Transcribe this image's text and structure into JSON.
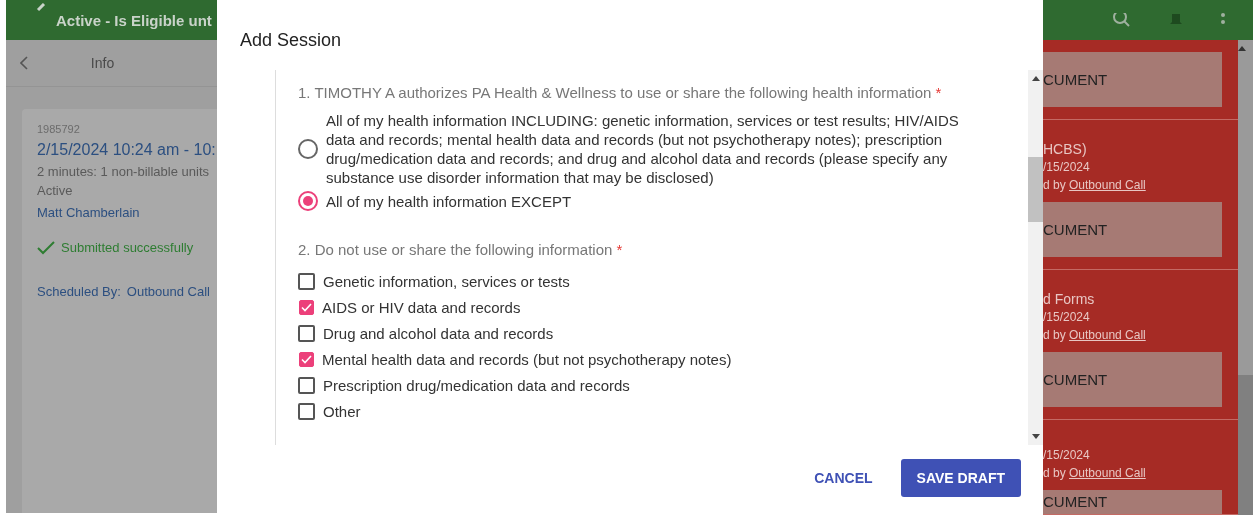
{
  "app_header": {
    "title": "Active - Is Eligible unt"
  },
  "info_bar": {
    "title": "Info"
  },
  "session_card": {
    "id": "1985792",
    "time": "2/15/2024 10:24 am - 10:",
    "duration": "2 minutes: 1 non-billable units",
    "status": "Active",
    "staff": "Matt Chamberlain",
    "result": "Submitted successfully",
    "scheduled_label": "Scheduled By:",
    "scheduled_by": "Outbound Call"
  },
  "dialog": {
    "title": "Add Session",
    "question_1": {
      "label": "1. TIMOTHY A authorizes PA Health & Wellness to use or share the following health information",
      "required": "*",
      "options": [
        {
          "label": "All of my health information INCLUDING: genetic information, services or test results; HIV/AIDS data and records; mental health data and records (but not psychotherapy notes); prescription drug/medication data and records; and drug and alcohol data and records (please specify any substance use disorder information that may be disclosed)",
          "selected": false
        },
        {
          "label": "All of my health information EXCEPT",
          "selected": true
        }
      ]
    },
    "question_2": {
      "label": "2. Do not use or share the following information",
      "required": "*",
      "options": [
        {
          "label": "Genetic information, services or tests",
          "checked": false
        },
        {
          "label": "AIDS or HIV data and records",
          "checked": true
        },
        {
          "label": "Drug and alcohol data and records",
          "checked": false
        },
        {
          "label": "Mental health data and records (but not psychotherapy notes)",
          "checked": true
        },
        {
          "label": "Prescription drug/medication data and records",
          "checked": false
        },
        {
          "label": "Other",
          "checked": false
        }
      ]
    },
    "buttons": [
      {
        "label": "CANCEL",
        "kind": "text"
      },
      {
        "label": "SAVE DRAFT",
        "kind": "primary"
      }
    ]
  },
  "documents": [
    {
      "action": "CUMENT"
    },
    {
      "title": "HCBS)",
      "date": "/15/2024",
      "by": "d by",
      "link": "Outbound Call",
      "action": "CUMENT"
    },
    {
      "title": "d Forms",
      "date": "/15/2024",
      "by": "d by",
      "link": "Outbound Call",
      "action": "CUMENT"
    },
    {
      "date": "/15/2024",
      "by": "d by",
      "link": "Outbound Call",
      "action": "CUMENT"
    }
  ]
}
